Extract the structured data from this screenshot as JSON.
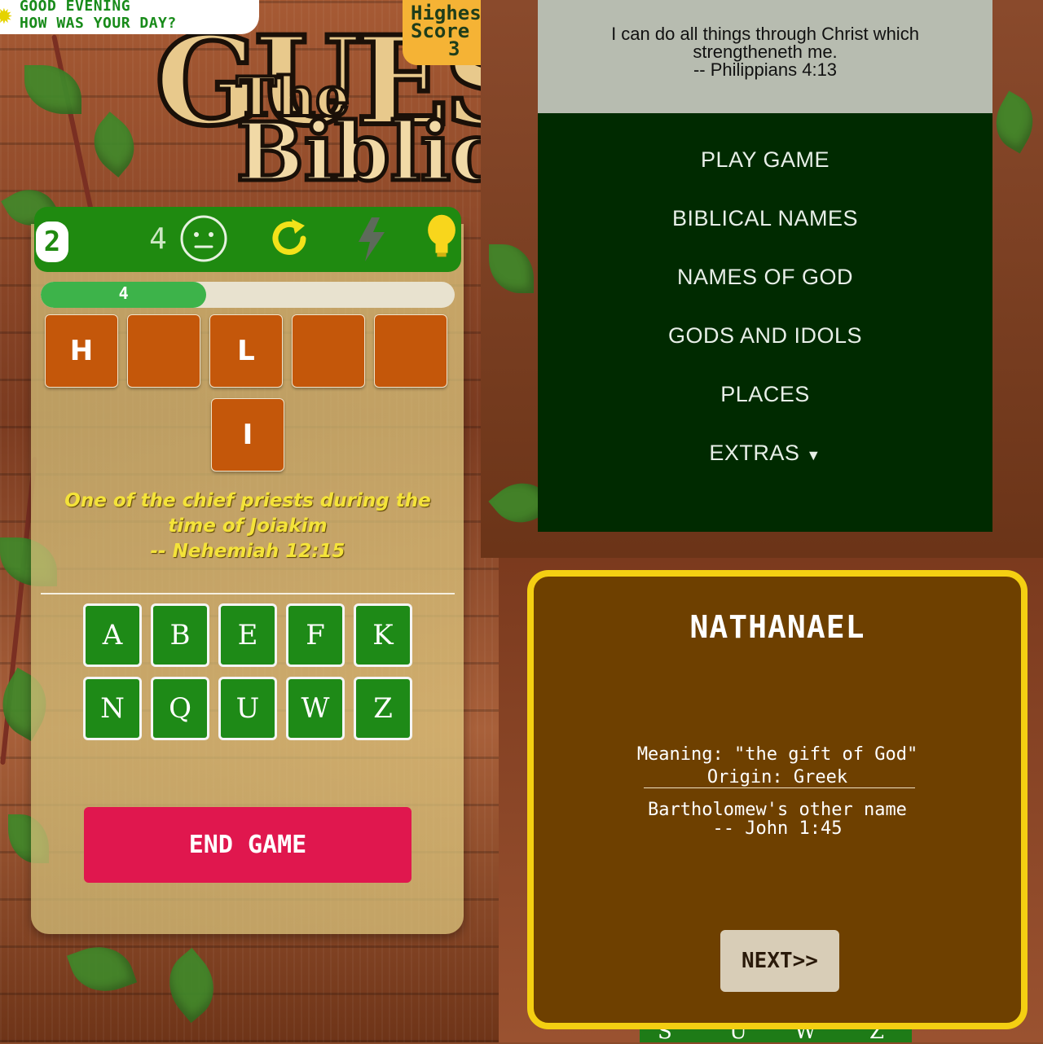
{
  "greeting": {
    "line1": "GOOD EVENING",
    "line2": "HOW WAS YOUR DAY?"
  },
  "high_score": {
    "label1": "Highes",
    "label2": "Score",
    "value": "3"
  },
  "logo": {
    "big": "GUESS",
    "the": "The",
    "biblical": "Biblical"
  },
  "toolbar": {
    "round": "2",
    "lives": "4"
  },
  "progress": {
    "label": "4",
    "fraction": 0.4
  },
  "tiles": [
    "H",
    "",
    "L",
    "",
    "",
    "I"
  ],
  "clue": {
    "line1": "One of the chief priests during the",
    "line2": "time of Joiakim",
    "line3": "-- Nehemiah 12:15"
  },
  "keys": [
    "A",
    "B",
    "E",
    "F",
    "K",
    "N",
    "Q",
    "U",
    "W",
    "Z"
  ],
  "end_button": "END GAME",
  "verse": {
    "line1": "I can do all things through Christ which",
    "line2": "strengtheneth me.",
    "line3": "-- Philippians 4:13"
  },
  "menu": [
    "PLAY GAME",
    "BIBLICAL NAMES",
    "NAMES OF GOD",
    "GODS AND IDOLS",
    "PLACES",
    "EXTRAS"
  ],
  "name_card": {
    "title": "NATHANAEL",
    "meaning": "Meaning: \"the gift of God\"",
    "origin": "Origin: Greek",
    "note": "Bartholomew's other name",
    "reference": "-- John 1:45",
    "next": "NEXT>>"
  },
  "bottom_strip": [
    "S",
    "U",
    "W",
    "Z"
  ],
  "colors": {
    "game_green": "#1f8a10",
    "tile_orange": "#c4570a",
    "end_red": "#e0174e",
    "menu_dark": "#002a00",
    "card_brown": "#6e4000",
    "card_border": "#f4cf12"
  }
}
